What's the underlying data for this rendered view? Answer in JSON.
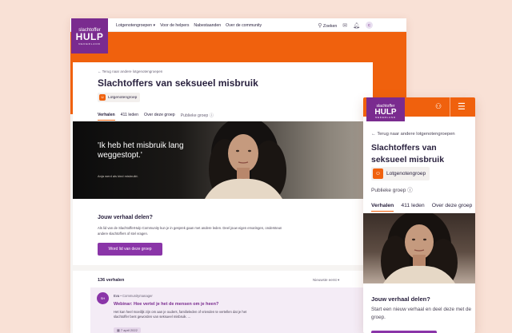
{
  "brand": {
    "line1": "slachtoffer",
    "line2": "HULP",
    "line3": "NEDERLAND",
    "colors": {
      "orange": "#f0610d",
      "purple": "#7a2b8f",
      "button": "#8a35a8",
      "background": "#f9e1d6"
    }
  },
  "desktop": {
    "nav": {
      "links": [
        "Lotgenotengroepen",
        "Voor de helpers",
        "Nabestaanden",
        "Over de community"
      ],
      "search_label": "Zoeken",
      "avatar_initial": "C"
    },
    "back_link": "Terug naar andere lotgenotengroepen",
    "title": "Slachtoffers van seksueel misbruik",
    "chip_label": "Lotgenotengroep",
    "tabs": [
      "Verhalen",
      "411 leden",
      "Over deze groep",
      "Publieke groep"
    ],
    "hero": {
      "quote": "'Ik heb het misbruik lang weggestopt.'",
      "caption": "Anja werd als kind misbruikt."
    },
    "share": {
      "heading": "Jouw verhaal delen?",
      "text": "Als lid van de SlachtofferHulp Community kun je in gesprek gaan met andere leden. Deel jouw eigen ervaringen, ondersteun andere slachtoffers of stel vragen.",
      "button": "Word lid van deze groep"
    },
    "stories": {
      "count": "136 verhalen",
      "sort": "Nieuwste eerst",
      "post": {
        "avatar": "SH",
        "author": "Eva",
        "role": "Communitymanager",
        "title": "Webinar: Hoe vertel je het de mensen om je heen?",
        "excerpt": "Het kan heel moeilijk zijn om aan je ouders, familieleden of vrienden te vertellen dat je het slachtoffer bent geworden van seksueel misbruik. ...",
        "date": "7 april 2022"
      }
    }
  },
  "mobile": {
    "back_link": "Terug naar andere lotgenotengroepen",
    "title": "Slachtoffers van seksueel misbruik",
    "chip_label": "Lotgenotengroep",
    "public_label": "Publieke groep",
    "tabs": [
      "Verhalen",
      "411 leden",
      "Over deze groep"
    ],
    "share_heading": "Jouw verhaal delen?",
    "share_text": "Start een nieuw verhaal en deel deze met de groep."
  }
}
